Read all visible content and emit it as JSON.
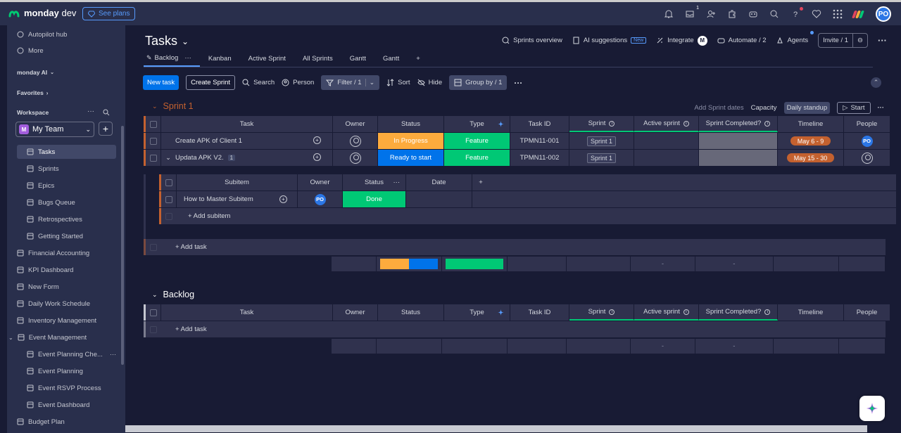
{
  "app": {
    "brand_bold": "monday",
    "brand_light": "dev",
    "see_plans": "See plans",
    "notif_count": "1",
    "avatar_initials": "PO"
  },
  "sidebar": {
    "top_items": [
      "Autopilot hub",
      "More"
    ],
    "monday_ai": "monday AI",
    "favorites": "Favorites",
    "workspace": "Workspace",
    "team": {
      "badge": "M",
      "name": "My Team"
    },
    "items": [
      {
        "label": "Tasks",
        "icon": "board-icon",
        "indent": true,
        "active": true
      },
      {
        "label": "Sprints",
        "icon": "sprint-icon",
        "indent": true
      },
      {
        "label": "Epics",
        "icon": "epic-icon",
        "indent": true
      },
      {
        "label": "Bugs Queue",
        "icon": "bug-icon",
        "indent": true
      },
      {
        "label": "Retrospectives",
        "icon": "retro-icon",
        "indent": true
      },
      {
        "label": "Getting Started",
        "icon": "doc-icon",
        "indent": true
      },
      {
        "label": "Financial Accounting",
        "icon": "board-icon"
      },
      {
        "label": "KPI Dashboard",
        "icon": "dashboard-icon"
      },
      {
        "label": "New Form",
        "icon": "form-icon"
      },
      {
        "label": "Daily Work Schedule",
        "icon": "board-icon"
      },
      {
        "label": "Inventory Management",
        "icon": "board-icon"
      },
      {
        "label": "Event Management",
        "icon": "folder-icon",
        "folder": true
      },
      {
        "label": "Event Planning Che...",
        "icon": "doc-icon",
        "indent": true
      },
      {
        "label": "Event Planning",
        "icon": "workflow-icon",
        "indent": true
      },
      {
        "label": "Event RSVP Process",
        "icon": "board-icon",
        "indent": true
      },
      {
        "label": "Event Dashboard",
        "icon": "dashboard-icon",
        "indent": true
      },
      {
        "label": "Budget Plan",
        "icon": "board-icon"
      }
    ]
  },
  "header": {
    "title": "Tasks",
    "actions": {
      "sprints_overview": "Sprints overview",
      "ai_suggestions": "AI suggestions",
      "new_badge": "New",
      "integrate": "Integrate",
      "automate": "Automate / 2",
      "agents": "Agents",
      "invite": "Invite / 1"
    }
  },
  "tabs": [
    "Backlog",
    "Kanban",
    "Active Sprint",
    "All Sprints",
    "Gantt",
    "Gantt"
  ],
  "toolbar": {
    "new_task": "New task",
    "create_sprint": "Create Sprint",
    "search": "Search",
    "person": "Person",
    "filter": "Filter / 1",
    "sort": "Sort",
    "hide": "Hide",
    "group_by": "Group by / 1"
  },
  "sprint_group": {
    "title": "Sprint 1",
    "color": "#c4612f",
    "actions": {
      "add_dates": "Add Sprint dates",
      "capacity": "Capacity",
      "daily_standup": "Daily standup",
      "start": "Start"
    },
    "columns": [
      "Task",
      "Owner",
      "Status",
      "Type",
      "Task ID",
      "Sprint",
      "Active sprint",
      "Sprint Completed?",
      "Timeline",
      "People"
    ],
    "rows": [
      {
        "task": "Create APK of Client 1",
        "status": "In Progress",
        "status_color": "#fdab3d",
        "type": "Feature",
        "type_color": "#00c875",
        "task_id": "TPMN11-001",
        "sprint": "Sprint 1",
        "timeline": "May 6 - 9",
        "people": "PO"
      },
      {
        "task": "Updata APK V2.",
        "subitems": "1",
        "status": "Ready to start",
        "status_color": "#0073ea",
        "type": "Feature",
        "type_color": "#00c875",
        "task_id": "TPMN11-002",
        "sprint": "Sprint 1",
        "timeline": "May 15 - 30",
        "people": ""
      }
    ],
    "subitems": {
      "columns": [
        "Subitem",
        "Owner",
        "Status",
        "Date"
      ],
      "rows": [
        {
          "name": "How to Master Subitem",
          "owner": "PO",
          "status": "Done",
          "status_color": "#00c875"
        }
      ],
      "add": "+ Add subitem"
    },
    "add_task": "+ Add task",
    "summary_dash": "-"
  },
  "backlog_group": {
    "title": "Backlog",
    "columns": [
      "Task",
      "Owner",
      "Status",
      "Type",
      "Task ID",
      "Sprint",
      "Active sprint",
      "Sprint Completed?",
      "Timeline",
      "People"
    ],
    "add_task": "+ Add task",
    "summary_dash": "-"
  }
}
